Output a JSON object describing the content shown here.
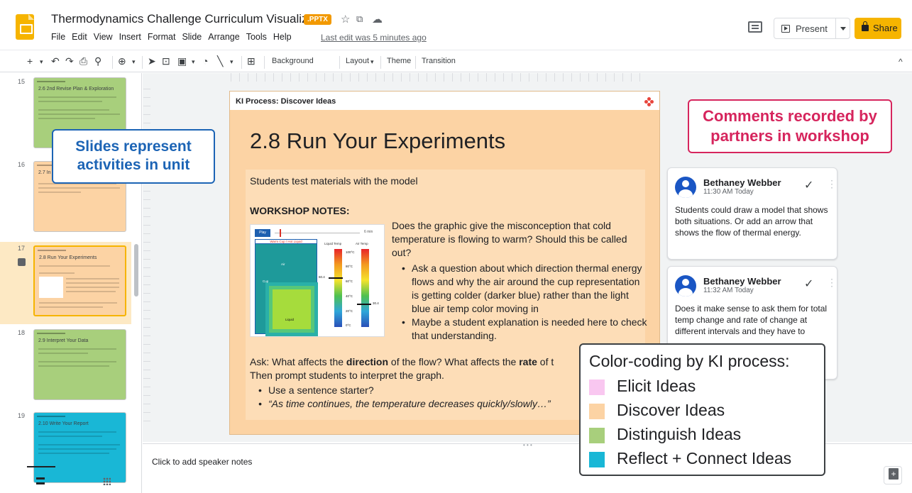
{
  "header": {
    "doc_title": "Thermodynamics Challenge Curriculum Visualizer",
    "badge": ".PPTX",
    "menu": [
      "File",
      "Edit",
      "View",
      "Insert",
      "Format",
      "Slide",
      "Arrange",
      "Tools",
      "Help"
    ],
    "last_edit": "Last edit was 5 minutes ago",
    "present_label": "Present",
    "share_label": "Share"
  },
  "toolbar": {
    "background": "Background",
    "layout": "Layout",
    "theme": "Theme",
    "transition": "Transition"
  },
  "filmstrip": {
    "slides": [
      {
        "number": "15",
        "title": "2.6 2nd Revise Plan & Exploration",
        "color": "#a8cf7c"
      },
      {
        "number": "16",
        "title": "2.7 In",
        "color": "#fcd3a4"
      },
      {
        "number": "17",
        "title": "2.8 Run Your Experiments",
        "color": "#fcd3a4",
        "selected": true
      },
      {
        "number": "18",
        "title": "2.9 Interpret Your Data",
        "color": "#a8cf7c"
      },
      {
        "number": "19",
        "title": "2.10 Write Your Report",
        "color": "#19b7d6"
      }
    ]
  },
  "slide": {
    "process_label": "KI Process: Discover Ideas",
    "heading": "2.8 Run Your Experiments",
    "intro": "Students test materials with the model",
    "notes_label": "WORKSHOP NOTES:",
    "question": "Does the graphic give the misconception that cold temperature is flowing to warm? Should this be called out?",
    "bullets": [
      "Ask a question about which direction thermal energy flows and why the air around the cup representation is getting colder (darker blue) rather than the light blue air temp color moving in",
      "Maybe a student explanation is needed here to check that understanding."
    ],
    "ask_1": "Ask: What affects the ",
    "ask_bold_1": "direction",
    "ask_2": " of the flow? What affects the ",
    "ask_bold_2": "rate",
    "ask_3": " of t",
    "ask_line2": "Then prompt students to interpret the graph.",
    "bullets2": [
      "Use a sentence starter?",
      "“As time continues, the temperature decreases quickly/slowly…”"
    ],
    "sim": {
      "play": "Play",
      "duration": "6 min",
      "view_title": "Warm Cup / Hot Liquid",
      "liquid_temp": "Liquid Temp",
      "air_temp": "Air Temp",
      "air": "Air",
      "cup": "Cup",
      "liquid": "Liquid",
      "ticks": [
        "100°C",
        "80°C",
        "60°C",
        "40°C",
        "20°C",
        "0°C"
      ],
      "liquid_value": "60.4",
      "air_value": "30.4"
    }
  },
  "speaker_notes": "Click to add speaker notes",
  "comments": [
    {
      "author": "Bethaney Webber",
      "time": "11:30 AM Today",
      "text": "Students could draw a model that shows both situations. Or add an arrow that shows the flow of thermal energy."
    },
    {
      "author": "Bethaney Webber",
      "time": "11:32 AM Today",
      "text": "Does it make sense to ask them for total temp change and rate of change at different intervals and they have to"
    }
  ],
  "callouts": {
    "slides": "Slides represent activities in unit",
    "comments": "Comments recorded by partners in workshop"
  },
  "legend": {
    "title": "Color-coding by KI process:",
    "items": [
      {
        "label": "Elicit Ideas",
        "color": "#f9c7f0"
      },
      {
        "label": "Discover Ideas",
        "color": "#fcd3a4"
      },
      {
        "label": "Distinguish Ideas",
        "color": "#a8cf7c"
      },
      {
        "label": "Reflect + Connect Ideas",
        "color": "#19b7d6"
      }
    ]
  }
}
